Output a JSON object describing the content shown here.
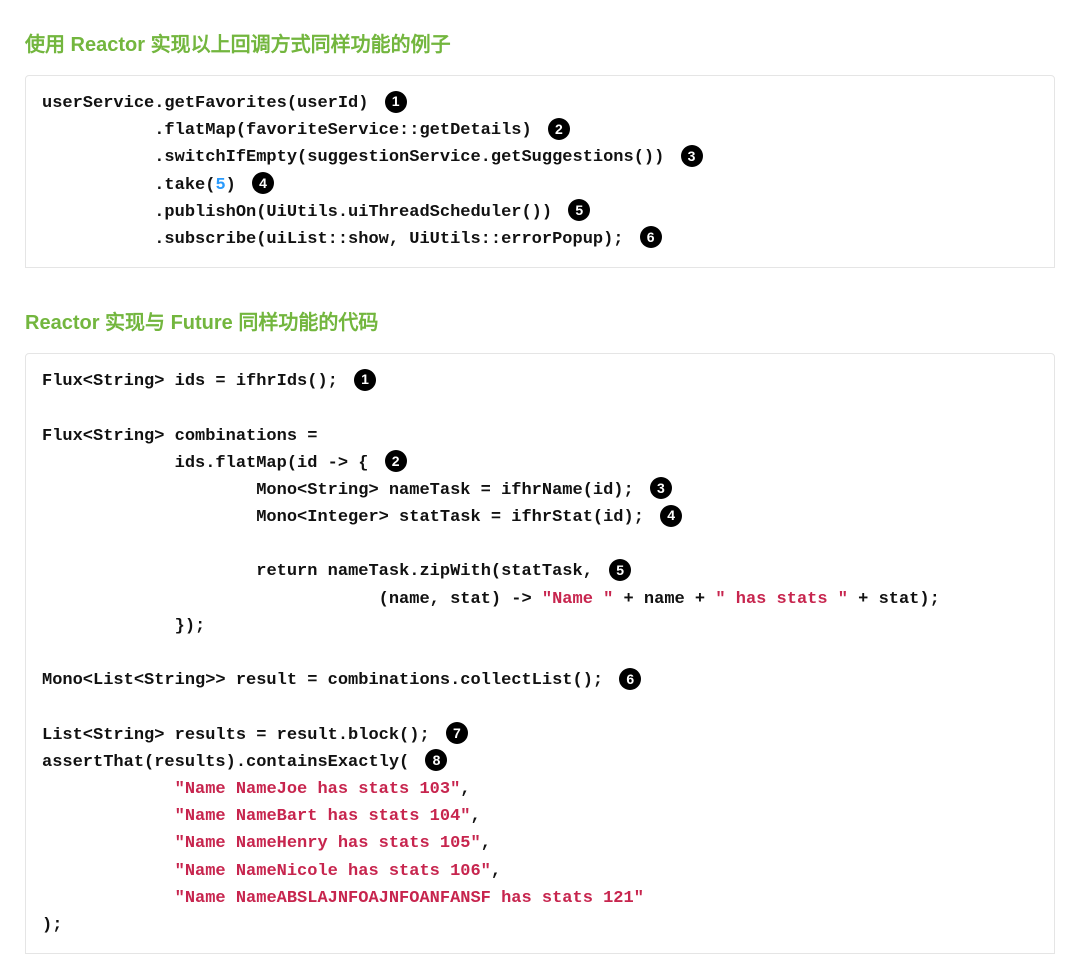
{
  "section1": {
    "title": "使用 Reactor 实现以上回调方式同样功能的例子",
    "code": {
      "l1a": "userService.getFavorites(userId) ",
      "b1": "1",
      "l2a": "           .flatMap(favoriteService::getDetails) ",
      "b2": "2",
      "l3a": "           .switchIfEmpty(suggestionService.getSuggestions()) ",
      "b3": "3",
      "l4a": "           .take(",
      "l4num": "5",
      "l4b": ") ",
      "b4": "4",
      "l5a": "           .publishOn(UiUtils.uiThreadScheduler()) ",
      "b5": "5",
      "l6a": "           .subscribe(uiList::show, UiUtils::errorPopup); ",
      "b6": "6"
    }
  },
  "section2": {
    "title": "Reactor 实现与 Future 同样功能的代码",
    "code": {
      "l1a": "Flux<String> ids = ifhrIds(); ",
      "b1": "1",
      "l3": "Flux<String> combinations =",
      "l4a": "             ids.flatMap(id -> { ",
      "b2": "2",
      "l5a": "                     Mono<String> nameTask = ifhrName(id); ",
      "b3": "3",
      "l6a": "                     Mono<Integer> statTask = ifhrStat(id); ",
      "b4": "4",
      "l8a": "                     ",
      "l8kw": "return",
      "l8b": " nameTask.zipWith(statTask, ",
      "b5": "5",
      "l9a": "                                 (name, stat) -> ",
      "l9s1": "\"Name \"",
      "l9b": " + name + ",
      "l9s2": "\" has stats \"",
      "l9c": " + stat);",
      "l10": "             });",
      "l12a": "Mono<List<String>> result = combinations.collectList(); ",
      "b6": "6",
      "l14a": "List<String> results = result.block(); ",
      "b7": "7",
      "l15a": "assertThat(results).containsExactly( ",
      "b8": "8",
      "l16pad": "             ",
      "l16s": "\"Name NameJoe has stats 103\"",
      "l16c": ",",
      "l17pad": "             ",
      "l17s": "\"Name NameBart has stats 104\"",
      "l17c": ",",
      "l18pad": "             ",
      "l18s": "\"Name NameHenry has stats 105\"",
      "l18c": ",",
      "l19pad": "             ",
      "l19s": "\"Name NameNicole has stats 106\"",
      "l19c": ",",
      "l20pad": "             ",
      "l20s": "\"Name NameABSLAJNFOAJNFOANFANSF has stats 121\"",
      "l21": ");"
    }
  }
}
